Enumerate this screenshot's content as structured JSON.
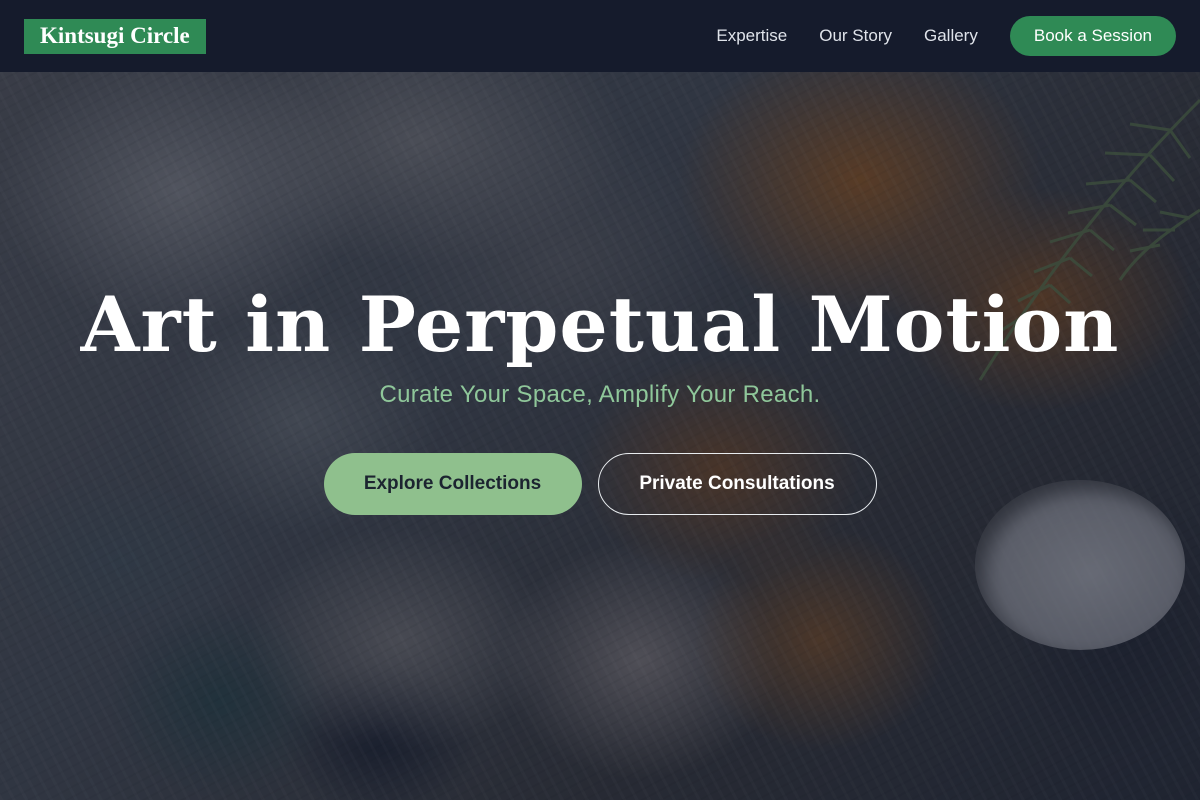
{
  "header": {
    "logo_text": "Kintsugi Circle",
    "nav_links": [
      "Expertise",
      "Our Story",
      "Gallery"
    ],
    "cta_label": "Book a Session"
  },
  "hero": {
    "title": "Art in Perpetual Motion",
    "subtitle": "Curate Your Space, Amplify Your Reach.",
    "primary_button": "Explore Collections",
    "secondary_button": "Private Consultations",
    "background": "abstract oil paint palette with rosemary sprig"
  },
  "colors": {
    "brand_green": "#2f8a55",
    "header_bg": "#151b2c",
    "primary_button_bg": "#8fc08d",
    "subtitle_green": "#8fc79a"
  }
}
